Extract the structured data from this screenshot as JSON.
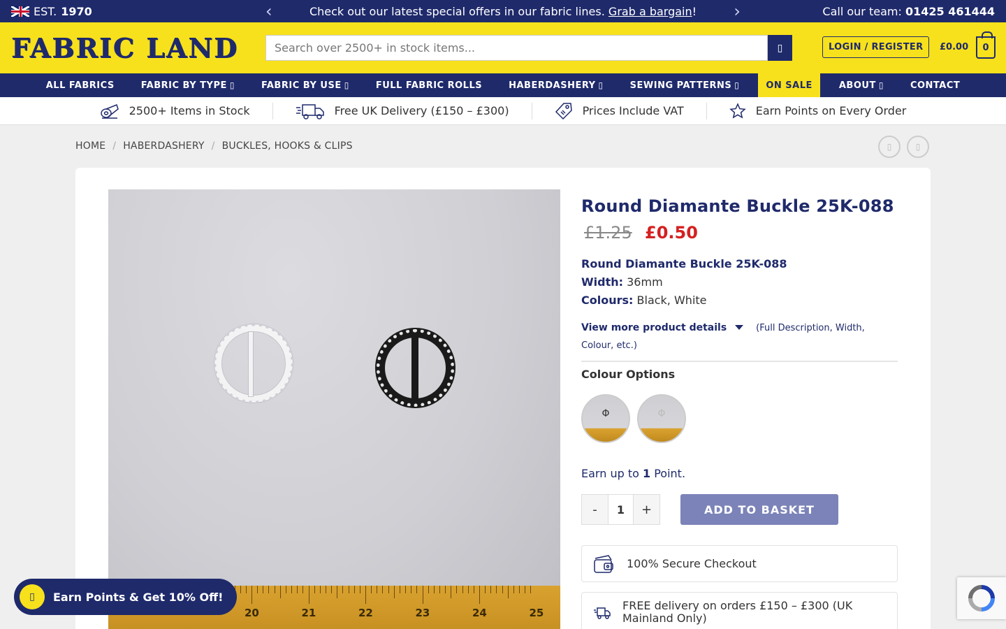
{
  "topbar": {
    "est_prefix": "EST.",
    "est_year": "1970",
    "promo_text": "Check out our latest special offers in our fabric lines.",
    "promo_link": "Grab a bargain",
    "promo_suffix": "!",
    "call_label": "Call our team:",
    "phone": "01425 461444"
  },
  "header": {
    "logo": "FABRIC LAND",
    "search_placeholder": "Search over 2500+ in stock items...",
    "login_label": "LOGIN / REGISTER",
    "cart_total": "£0.00",
    "cart_count": "0"
  },
  "nav": {
    "items": [
      {
        "label": "ALL FABRICS",
        "caret": ""
      },
      {
        "label": "FABRIC BY TYPE",
        "caret": "▯"
      },
      {
        "label": "FABRIC BY USE",
        "caret": "▯"
      },
      {
        "label": "FULL FABRIC ROLLS",
        "caret": ""
      },
      {
        "label": "HABERDASHERY",
        "caret": "▯"
      },
      {
        "label": "SEWING PATTERNS",
        "caret": "▯"
      },
      {
        "label": "ON SALE",
        "caret": ""
      },
      {
        "label": "ABOUT",
        "caret": "▯"
      },
      {
        "label": "CONTACT",
        "caret": ""
      }
    ]
  },
  "usp": [
    {
      "label": "2500+ Items in Stock",
      "icon": "fabric-roll-icon"
    },
    {
      "label": "Free UK Delivery (£150 – £300)",
      "icon": "delivery-truck-icon"
    },
    {
      "label": "Prices Include VAT",
      "icon": "price-tag-icon"
    },
    {
      "label": "Earn Points on Every Order",
      "icon": "star-icon"
    }
  ],
  "breadcrumb": [
    "HOME",
    "HABERDASHERY",
    "BUCKLES, HOOKS & CLIPS"
  ],
  "breadcrumb_sep": "/",
  "product": {
    "title": "Round Diamante Buckle 25K-088",
    "old_price": "£1.25",
    "new_price": "£0.50",
    "desc_name": "Round Diamante Buckle 25K-088",
    "width_label": "Width:",
    "width_value": "36mm",
    "colours_label": "Colours:",
    "colours_value": "Black, White",
    "more_label": "View more product details",
    "more_hint": "(Full Description, Width, Colour, etc.)",
    "options_label": "Colour Options",
    "points_prefix": "Earn up to",
    "points_value": "1",
    "points_suffix": "Point.",
    "qty_minus": "-",
    "qty_value": "1",
    "qty_plus": "+",
    "add_label": "ADD TO BASKET",
    "secure_label": "100% Secure Checkout",
    "delivery_label": "FREE delivery on orders £150 – £300 (UK Mainland Only)"
  },
  "ruler_numbers": [
    "20",
    "21",
    "22",
    "23",
    "24",
    "25"
  ],
  "earn_badge": "Earn Points & Get 10% Off!",
  "icon_glyph": "▯",
  "colors": {
    "navy": "#1f2a6b",
    "yellow": "#f7e11c",
    "sale_red": "#d42020",
    "add_button": "#7b83b8"
  }
}
